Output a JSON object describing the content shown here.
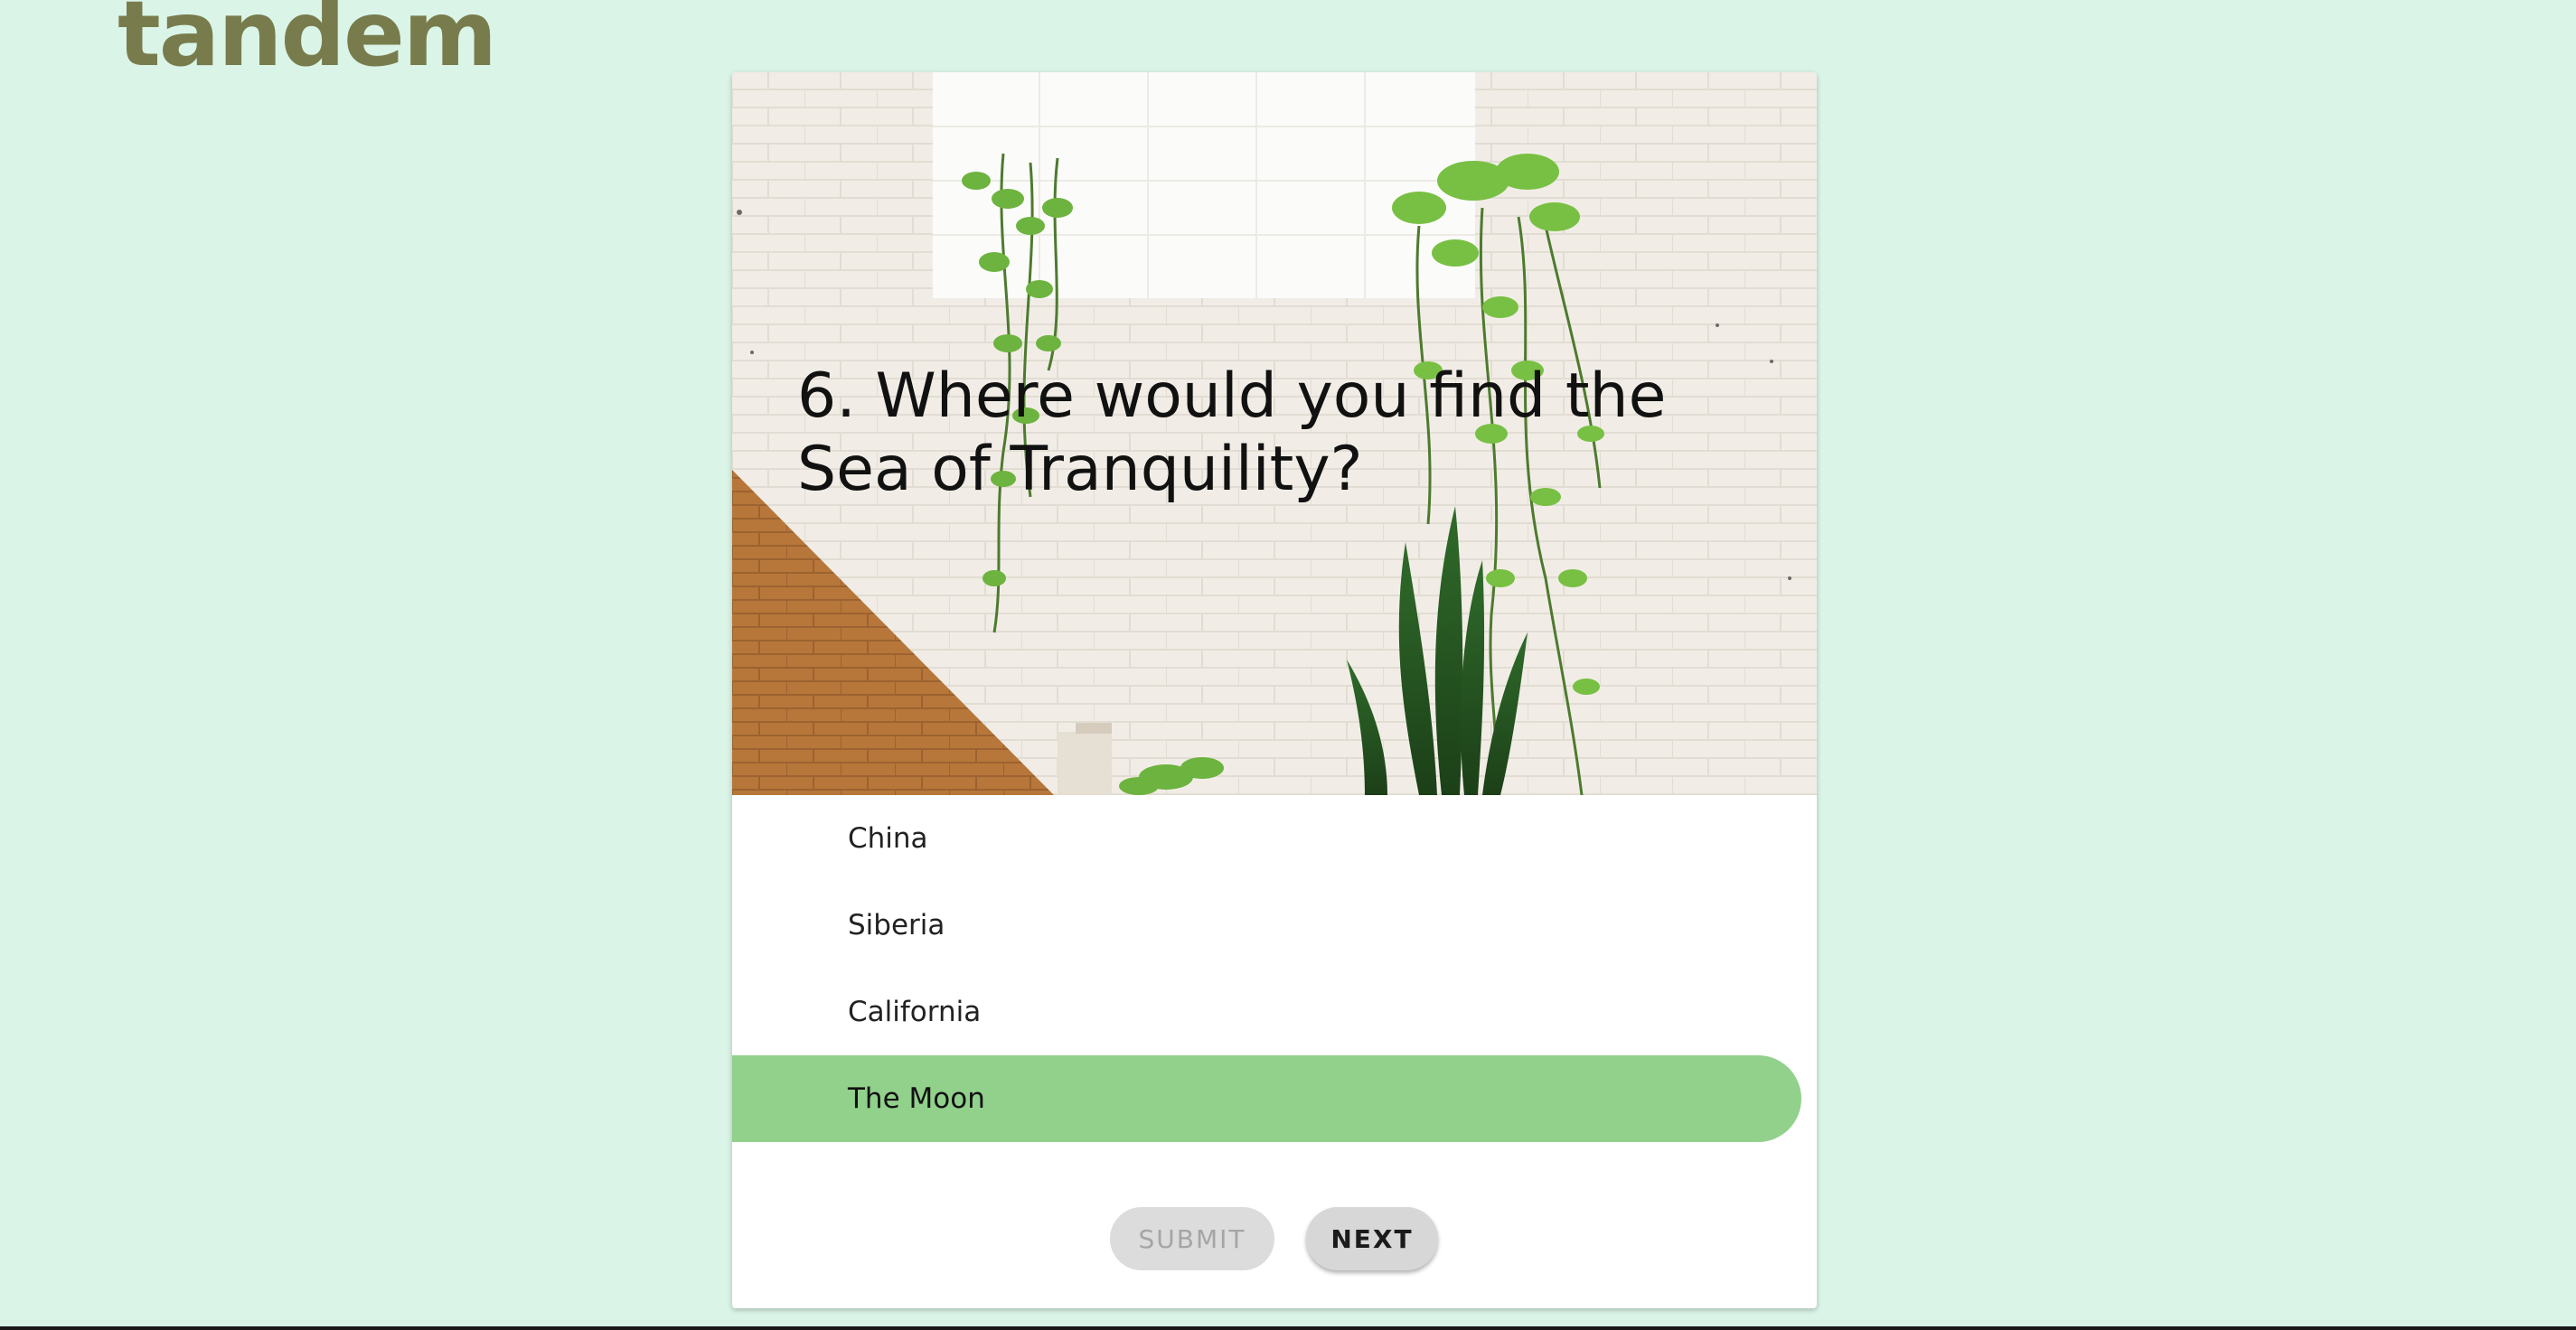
{
  "brand": {
    "logo_text": "tandem"
  },
  "quiz": {
    "question": "6. Where would you find the Sea of Tranquility?",
    "options": [
      {
        "label": "China",
        "selected": false
      },
      {
        "label": "Siberia",
        "selected": false
      },
      {
        "label": "California",
        "selected": false
      },
      {
        "label": "The Moon",
        "selected": true
      }
    ],
    "hero_image_icon": "plants-on-brick-wall-photo"
  },
  "actions": {
    "submit_label": "SUBMIT",
    "submit_enabled": false,
    "next_label": "NEXT"
  },
  "colors": {
    "page_background": "#daf5e8",
    "logo": "#787c4d",
    "selected_option": "#91d18b",
    "button_gray": "#d7d7d7"
  }
}
